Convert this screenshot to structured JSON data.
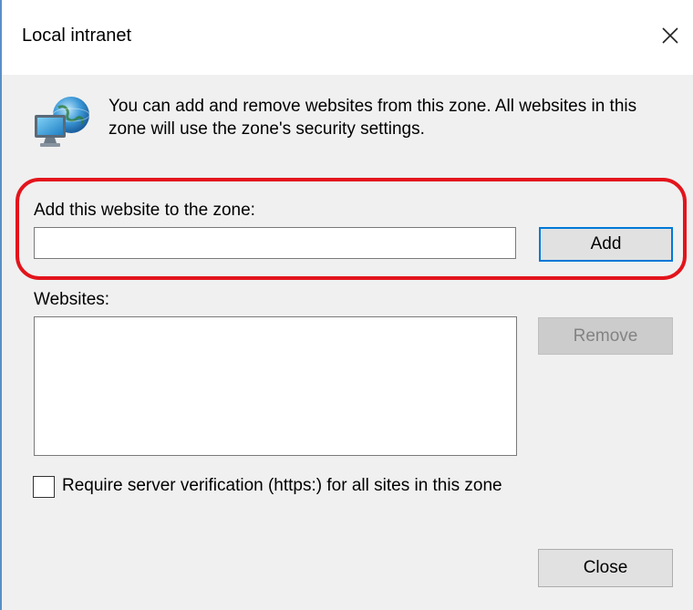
{
  "window": {
    "title": "Local intranet"
  },
  "description": "You can add and remove websites from this zone. All websites in this zone will use the zone's security settings.",
  "add_section": {
    "label": "Add this website to the zone:",
    "input_value": "",
    "add_button_label": "Add"
  },
  "websites_section": {
    "label": "Websites:",
    "items": [],
    "remove_button_label": "Remove"
  },
  "require_verification": {
    "label": "Require server verification (https:) for all sites in this zone",
    "checked": false
  },
  "footer": {
    "close_button_label": "Close"
  },
  "icons": {
    "zone": "globe-computer-icon",
    "close": "close-icon"
  },
  "colors": {
    "highlight": "#e3141c",
    "focus_border": "#0078d7",
    "dialog_background": "#f0f0f0"
  }
}
